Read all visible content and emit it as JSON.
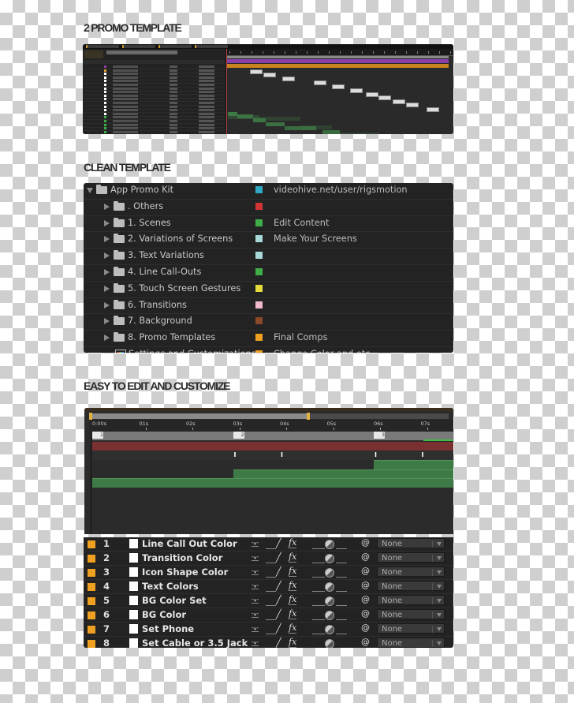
{
  "sections": {
    "promo_title": "2 PROMO TEMPLATE",
    "clean_title": "CLEAN TEMPLATE",
    "easy_title": "EASY TO EDIT AND CUSTOMIZE"
  },
  "promo_panel": {
    "layer_swatch_colors": [
      "#8a3fa8",
      "#e0a030",
      "#ffffff",
      "#ffffff",
      "#ffffff",
      "#ffffff",
      "#ffffff",
      "#ffffff",
      "#ffffff",
      "#ffffff",
      "#ffffff",
      "#ffffff",
      "#ffffff",
      "#ffffff",
      "#3fae49",
      "#3fae49",
      "#3fae49",
      "#3fae49",
      "#3fae49",
      "#3fae49"
    ],
    "track_colors": {
      "gray": "#8a8a8a",
      "purple": "#8a3fa8",
      "orange": "#c8821e",
      "green": "#3e7a45"
    }
  },
  "project_panel": {
    "items": [
      {
        "name": "App Promo Kit",
        "type": "folder",
        "expanded": true,
        "label_color": "#2eaac4",
        "comment": "videohive.net/user/rigsmotion",
        "indent": 0
      },
      {
        "name": ". Others",
        "type": "folder",
        "expanded": false,
        "label_color": "#d03535",
        "comment": "",
        "indent": 1
      },
      {
        "name": "1. Scenes",
        "type": "folder",
        "expanded": false,
        "label_color": "#3fae49",
        "comment": "Edit Content",
        "indent": 1
      },
      {
        "name": "2. Variations of Screens",
        "type": "folder",
        "expanded": false,
        "label_color": "#a8d8d8",
        "comment": "Make Your Screens",
        "indent": 1
      },
      {
        "name": "3. Text Variations",
        "type": "folder",
        "expanded": false,
        "label_color": "#a8d8d8",
        "comment": "",
        "indent": 1
      },
      {
        "name": "4. Line Call-Outs",
        "type": "folder",
        "expanded": false,
        "label_color": "#3fae49",
        "comment": "",
        "indent": 1
      },
      {
        "name": "5. Touch Screen Gestures",
        "type": "folder",
        "expanded": false,
        "label_color": "#e6dc3c",
        "comment": "",
        "indent": 1
      },
      {
        "name": "6. Transitions",
        "type": "folder",
        "expanded": false,
        "label_color": "#f0b8cc",
        "comment": "",
        "indent": 1
      },
      {
        "name": "7. Background",
        "type": "folder",
        "expanded": false,
        "label_color": "#8a4a2a",
        "comment": "",
        "indent": 1
      },
      {
        "name": "8. Promo Templates",
        "type": "folder",
        "expanded": false,
        "label_color": "#f0a020",
        "comment": "Final Comps",
        "indent": 1
      },
      {
        "name": "Settings and Customizations",
        "type": "composition",
        "expanded": false,
        "label_color": "#f0a020",
        "comment": "Change Color and etc",
        "indent": 1
      }
    ]
  },
  "timeline": {
    "ruler_labels": [
      "0:00s",
      "01s",
      "02s",
      "03s",
      "04s",
      "05s",
      "06s",
      "07s"
    ],
    "work_area_fraction": 0.61,
    "markers": [
      {
        "label": "1",
        "time_s": 0.0
      },
      {
        "label": "2",
        "time_s": 3.0
      },
      {
        "label": "3",
        "time_s": 6.0
      }
    ],
    "keyframes_s": [
      3.0,
      4.0,
      6.0,
      7.0
    ],
    "track_colors": {
      "red": "#7a3030",
      "green": "#3e7a45",
      "gray": "#7a7a7a"
    }
  },
  "layers": {
    "rows": [
      {
        "num": "1",
        "name": "Line Call Out Color",
        "parent": "None"
      },
      {
        "num": "2",
        "name": "Transition Color",
        "parent": "None"
      },
      {
        "num": "3",
        "name": "Icon Shape Color",
        "parent": "None"
      },
      {
        "num": "4",
        "name": "Text Colors",
        "parent": "None"
      },
      {
        "num": "5",
        "name": "BG Color Set",
        "parent": "None"
      },
      {
        "num": "6",
        "name": "BG Color",
        "parent": "None"
      },
      {
        "num": "7",
        "name": "Set Phone",
        "parent": "None"
      },
      {
        "num": "8",
        "name": "Set Cable or 3.5 Jack",
        "parent": "None"
      }
    ],
    "label_color": "#f0a020",
    "icons": {
      "shy": "-ᵩ-",
      "pen": "╱",
      "fx": "fx",
      "spiral": "@"
    }
  }
}
